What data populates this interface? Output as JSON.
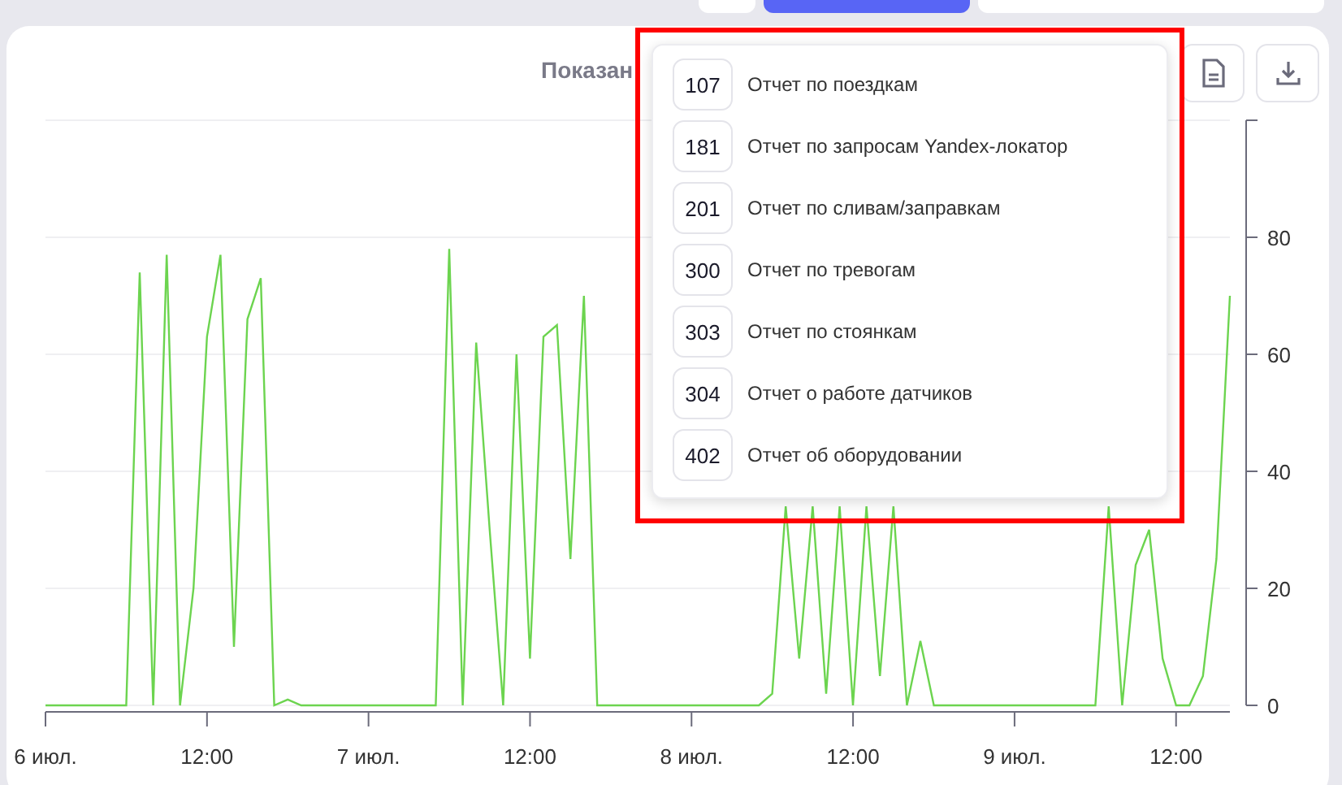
{
  "top_buttons": [
    {
      "selected": false
    },
    {
      "selected": true
    },
    {
      "selected": false
    }
  ],
  "card": {
    "title": "Показан",
    "chart_data": {
      "type": "line",
      "grid": true,
      "ylim": [
        0,
        100
      ],
      "yticks": [
        0,
        20,
        40,
        60,
        80
      ],
      "categories": [
        "6 июл.",
        null,
        null,
        null,
        null,
        null,
        null,
        null,
        null,
        null,
        null,
        null,
        "12:00",
        null,
        null,
        null,
        null,
        null,
        null,
        null,
        null,
        null,
        null,
        null,
        "7 июл.",
        null,
        null,
        null,
        null,
        null,
        null,
        null,
        null,
        null,
        null,
        null,
        "12:00",
        null,
        null,
        null,
        null,
        null,
        null,
        null,
        null,
        null,
        null,
        null,
        "8 июл.",
        null,
        null,
        null,
        null,
        null,
        null,
        null,
        null,
        null,
        null,
        null,
        "12:00",
        null,
        null,
        null,
        null,
        null,
        null,
        null,
        null,
        null,
        null,
        null,
        "9 июл.",
        null,
        null,
        null,
        null,
        null,
        null,
        null,
        null,
        null,
        null,
        null,
        "12:00",
        null,
        null,
        null,
        null
      ],
      "series": [
        {
          "color": "#6cd44f",
          "values": [
            0,
            0,
            0,
            0,
            0,
            0,
            0,
            74,
            0,
            77,
            0,
            20,
            63,
            77,
            10,
            66,
            73,
            0,
            1,
            0,
            0,
            0,
            0,
            0,
            0,
            0,
            0,
            0,
            0,
            0,
            78,
            0,
            62,
            30,
            0,
            60,
            8,
            63,
            65,
            25,
            70,
            0,
            0,
            0,
            0,
            0,
            0,
            0,
            0,
            0,
            0,
            0,
            0,
            0,
            2,
            34,
            8,
            34,
            2,
            34,
            0,
            34,
            5,
            34,
            0,
            11,
            0,
            0,
            0,
            0,
            0,
            0,
            0,
            0,
            0,
            0,
            0,
            0,
            0,
            34,
            0,
            24,
            30,
            8,
            0,
            0,
            5,
            25,
            70
          ]
        }
      ]
    }
  },
  "actions": [
    {
      "kind": "document"
    },
    {
      "kind": "download"
    }
  ],
  "menu": {
    "highlighted": true,
    "items": [
      {
        "code": "107",
        "label": "Отчет по поездкам"
      },
      {
        "code": "181",
        "label": "Отчет по запросам Yandex-локатор"
      },
      {
        "code": "201",
        "label": "Отчет по сливам/заправкам"
      },
      {
        "code": "300",
        "label": "Отчет по тревогам"
      },
      {
        "code": "303",
        "label": "Отчет по стоянкам"
      },
      {
        "code": "304",
        "label": "Отчет о работе датчиков"
      },
      {
        "code": "402",
        "label": "Отчет об оборудовании"
      }
    ]
  }
}
